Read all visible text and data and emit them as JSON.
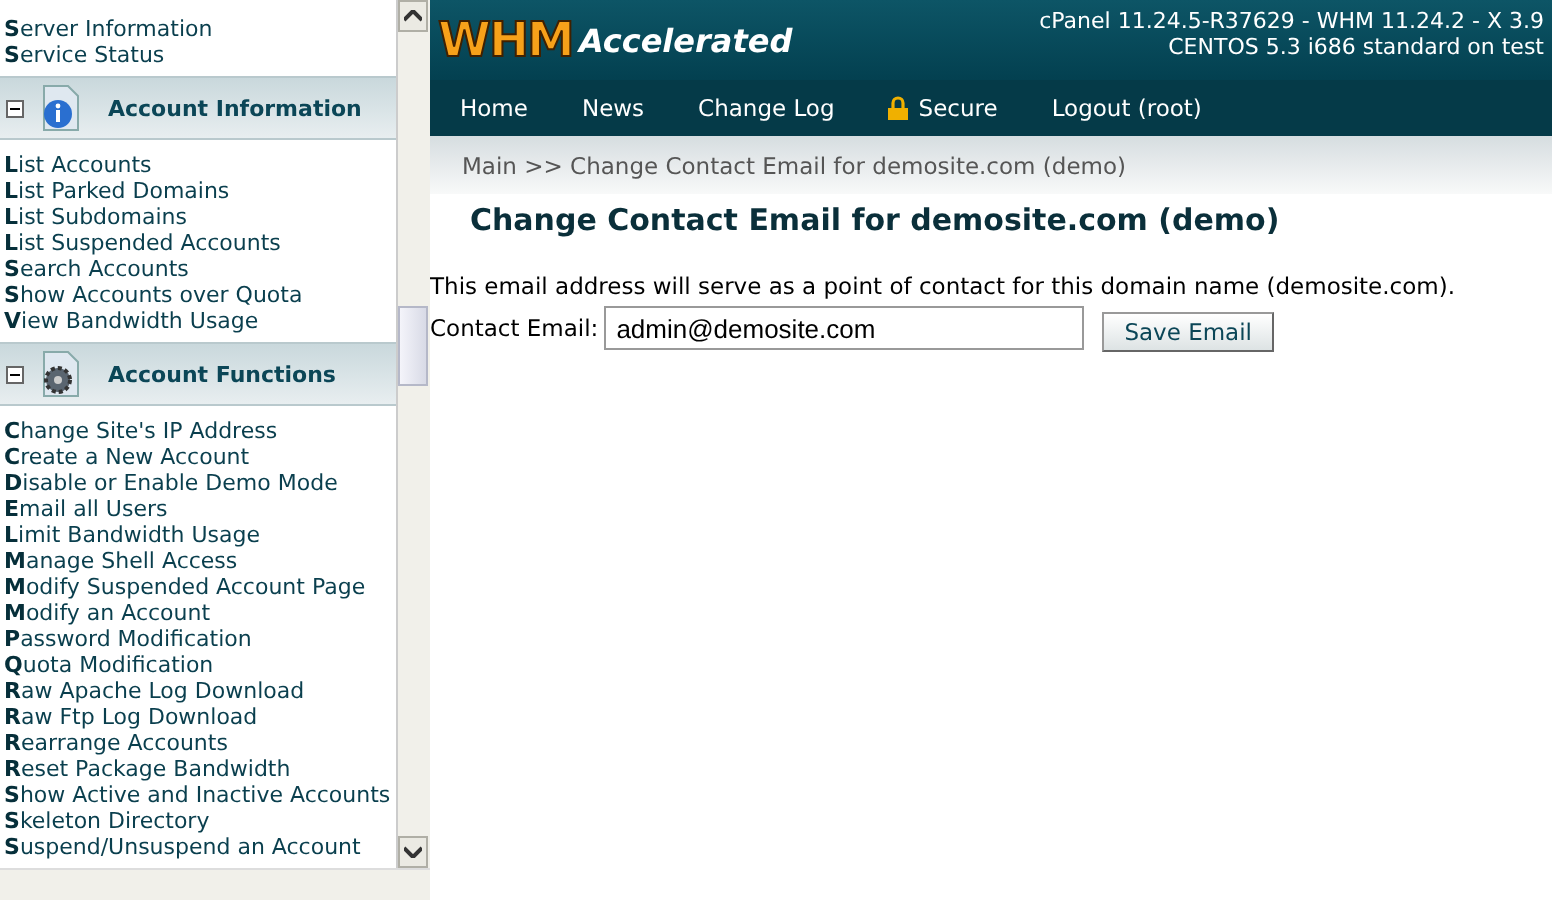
{
  "sidebar": {
    "groups": [
      {
        "items": [
          "**S**erver Information",
          "**S**ervice Status"
        ]
      },
      {
        "title": "Account Information",
        "expanded": true,
        "items": [
          "**L**ist Accounts",
          "**L**ist Parked Domains",
          "**L**ist Subdomains",
          "**L**ist Suspended Accounts",
          "**S**earch Accounts",
          "**S**how Accounts over Quota",
          "**V**iew Bandwidth Usage"
        ]
      },
      {
        "title": "Account Functions",
        "expanded": true,
        "items": [
          "**C**hange Site's IP Address",
          "**C**reate a New Account",
          "**D**isable or Enable Demo Mode",
          "**E**mail all Users",
          "**L**imit Bandwidth Usage",
          "**M**anage Shell Access",
          "**M**odify Suspended Account Page",
          "**M**odify an Account",
          "**P**assword Modification",
          "**Q**uota Modification",
          "**R**aw Apache Log Download",
          "**R**aw Ftp Log Download",
          "**R**earrange Accounts",
          "**R**eset Package Bandwidth",
          "**S**how Active and Inactive Accounts",
          "**S**keleton Directory",
          "**S**uspend/Unsuspend an Account"
        ]
      }
    ]
  },
  "header": {
    "logo_main": "WHM",
    "logo_sub": "Accelerated",
    "version_lines": [
      "cPanel 11.24.5-R37629 - WHM 11.24.2 - X 3.9",
      "CENTOS 5.3 i686 standard on test"
    ]
  },
  "nav": [
    {
      "label": "Home",
      "kind": "plain"
    },
    {
      "label": "News",
      "kind": "plain"
    },
    {
      "label": "Change Log",
      "kind": "plain"
    },
    {
      "label": "Secure",
      "kind": "lock"
    },
    {
      "label": "Logout (root)",
      "kind": "plain"
    }
  ],
  "breadcrumb": "Main >> Change Contact Email for demosite.com (demo)",
  "page_title": "Change Contact Email for demosite.com (demo)",
  "description": "This email address will serve as a point of contact for this domain name (demosite.com).",
  "form": {
    "label": "Contact Email:",
    "value": "admin@demosite.com",
    "button": "Save Email"
  }
}
